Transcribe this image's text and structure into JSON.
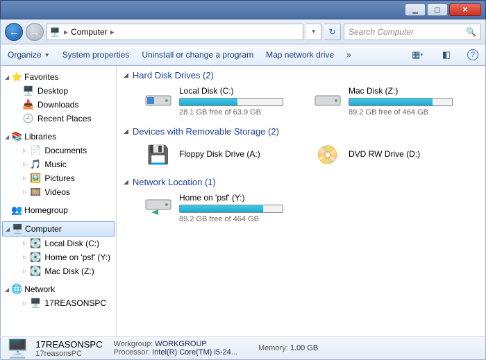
{
  "breadcrumb": {
    "location": "Computer"
  },
  "search": {
    "placeholder": "Search Computer"
  },
  "toolbar": {
    "organize": "Organize",
    "sysprops": "System properties",
    "uninstall": "Uninstall or change a program",
    "mapdrive": "Map network drive",
    "more": "»"
  },
  "sidebar": {
    "favorites": {
      "label": "Favorites",
      "items": [
        "Desktop",
        "Downloads",
        "Recent Places"
      ]
    },
    "libraries": {
      "label": "Libraries",
      "items": [
        "Documents",
        "Music",
        "Pictures",
        "Videos"
      ]
    },
    "homegroup": {
      "label": "Homegroup"
    },
    "computer": {
      "label": "Computer",
      "items": [
        "Local Disk (C:)",
        "Home on 'psf' (Y:)",
        "Mac Disk (Z:)"
      ]
    },
    "network": {
      "label": "Network",
      "items": [
        "17REASONSPC"
      ]
    }
  },
  "sections": {
    "hdd": {
      "title": "Hard Disk Drives (2)",
      "drives": [
        {
          "name": "Local Disk (C:)",
          "status": "28.1 GB free of 63.9 GB",
          "fill": 56
        },
        {
          "name": "Mac Disk (Z:)",
          "status": "89.2 GB free of 464 GB",
          "fill": 81
        }
      ]
    },
    "removable": {
      "title": "Devices with Removable Storage (2)",
      "drives": [
        {
          "name": "Floppy Disk Drive (A:)"
        },
        {
          "name": "DVD RW Drive (D:)"
        }
      ]
    },
    "network": {
      "title": "Network Location (1)",
      "drives": [
        {
          "name": "Home on 'psf' (Y:)",
          "status": "89.2 GB free of 464 GB",
          "fill": 81
        }
      ]
    }
  },
  "status": {
    "name": "17REASONSPC",
    "domain": "17reasonsPC",
    "wg_label": "Workgroup:",
    "wg": "WORKGROUP",
    "mem_label": "Memory:",
    "mem": "1.00 GB",
    "cpu_label": "Processor:",
    "cpu": "Intel(R) Core(TM) i5-24..."
  }
}
